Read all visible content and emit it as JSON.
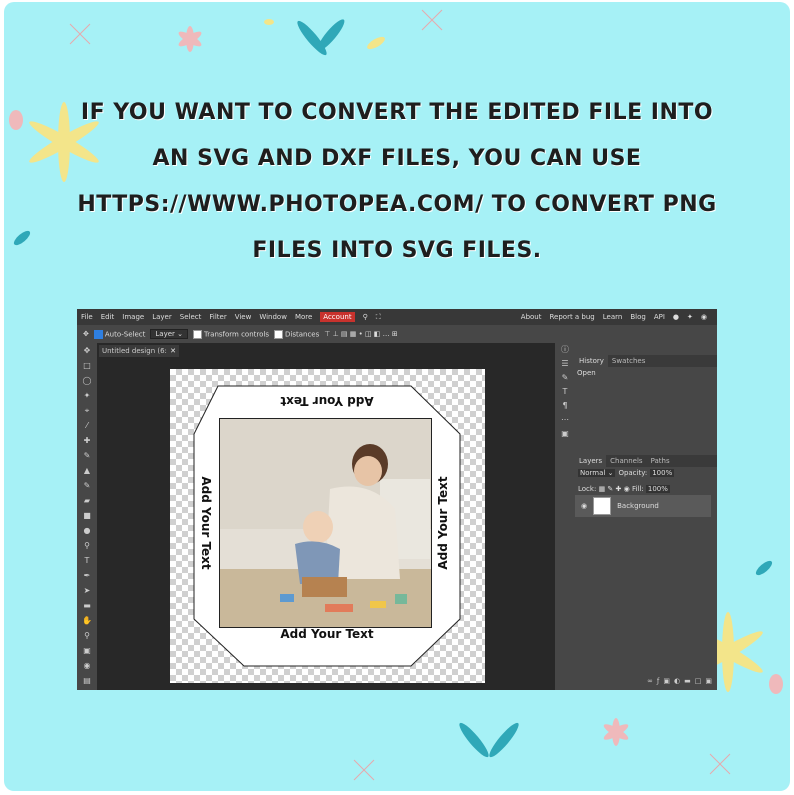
{
  "headline": "If you want to convert the edited file into an SVG and DXF files, you can use https://www.photopea.com/ to convert PNG files into SVG files.",
  "app": {
    "menu": [
      "File",
      "Edit",
      "Image",
      "Layer",
      "Select",
      "Filter",
      "View",
      "Window",
      "More"
    ],
    "account_label": "Account",
    "right_menu": [
      "About",
      "Report a bug",
      "Learn",
      "Blog",
      "API"
    ],
    "options": {
      "auto_select_label": "Auto-Select",
      "layer_select": "Layer",
      "transform_controls_label": "Transform controls",
      "distances_label": "Distances"
    },
    "doc_tab_title": "Untitled design (6:",
    "canvas_texts": {
      "top": "Add Your Text",
      "bottom": "Add Your Text",
      "left": "Add Your Text",
      "right": "Add Your Text"
    },
    "history_panel": {
      "tabs": [
        "History",
        "Swatches"
      ],
      "items": [
        "Open"
      ]
    },
    "layers_panel": {
      "tabs": [
        "Layers",
        "Channels",
        "Paths"
      ],
      "blend_mode": "Normal",
      "opacity_label": "Opacity:",
      "opacity_value": "100%",
      "lock_label": "Lock:",
      "fill_label": "Fill:",
      "fill_value": "100%",
      "layers": [
        {
          "name": "Background"
        }
      ]
    },
    "colors": {
      "background": "#a6f1f6",
      "account_button": "#c8322d",
      "app_dark": "#474747"
    }
  }
}
